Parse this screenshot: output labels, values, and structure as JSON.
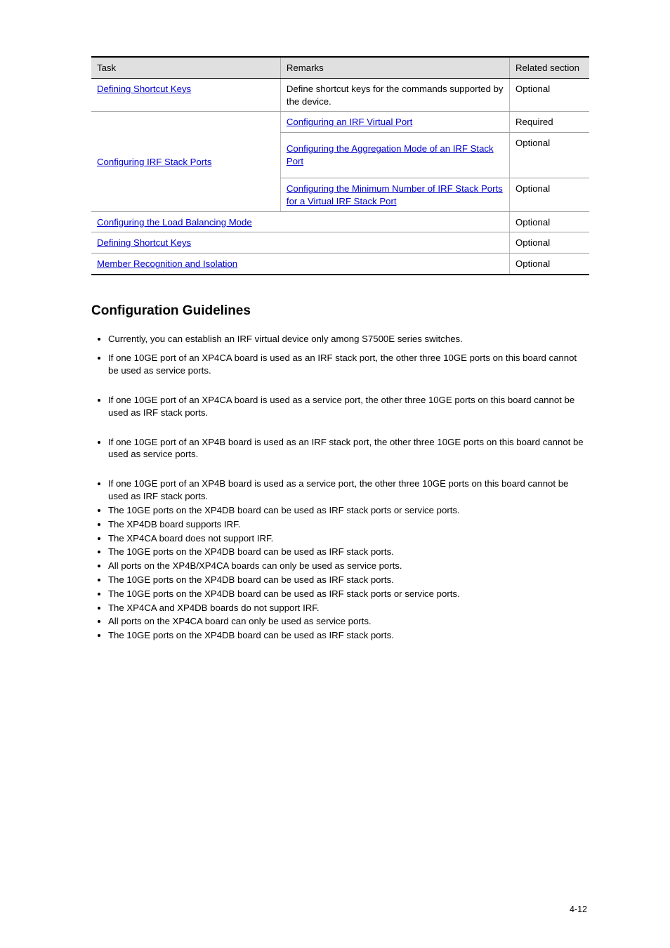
{
  "table": {
    "headers": {
      "task": "Task",
      "remarks": "Remarks",
      "related": "Related section"
    },
    "rows": [
      {
        "task_link": "Defining Shortcut Keys",
        "task_text": "",
        "remarks_pre": "Define shortcut keys for the commands supported by the device.",
        "remarks_links": [],
        "related": "Optional"
      },
      {
        "task_link": "",
        "task_text": "",
        "remarks_pre": "",
        "remarks_links": [
          {
            "text": "Configuring an IRF Virtual Port",
            "suffix": ""
          }
        ],
        "related": "Required"
      },
      {
        "task_link": "Configuring IRF Stack Ports",
        "task_text": "",
        "remarks_pre": "",
        "remarks_links": [
          {
            "text": "Configuring the Aggregation Mode of an IRF Stack Port",
            "suffix": ""
          }
        ],
        "related": "Optional"
      },
      {
        "task_link": "",
        "task_text": "",
        "remarks_pre": "",
        "remarks_links": [
          {
            "text": "Configuring the Minimum Number of IRF Stack Ports for a Virtual IRF Stack Port",
            "suffix": ""
          }
        ],
        "related": "Optional"
      },
      {
        "task_link": "Configuring the Load Balancing Mode",
        "task_text": "",
        "remarks_pre": "",
        "remarks_links": [],
        "related": "Optional"
      },
      {
        "task_link": "Defining Shortcut Keys",
        "task_text": "",
        "remarks_pre": "",
        "remarks_links": [],
        "related": "Optional"
      },
      {
        "task_link": "Member Recognition and Isolation",
        "task_text": "",
        "remarks_pre": "",
        "remarks_links": [],
        "related": "Optional"
      }
    ]
  },
  "section": {
    "heading": "Configuration Guidelines",
    "items": [
      {
        "text": "Currently, you can establish an IRF virtual device only among S7500E series switches.",
        "spacing": "sp-small"
      },
      {
        "text": "If one 10GE port of an XP4CA board is used as an IRF stack port, the other three 10GE ports on this board cannot be used as service ports.",
        "spacing": "sp"
      },
      {
        "text": "If one 10GE port of an XP4CA board is used as a service port, the other three 10GE ports on this board cannot be used as IRF stack ports.",
        "spacing": "sp"
      },
      {
        "text": "If one 10GE port of an XP4B board is used as an IRF stack port, the other three 10GE ports on this board cannot be used as service ports.",
        "spacing": "sp"
      },
      {
        "text": "If one 10GE port of an XP4B board is used as a service port, the other three 10GE ports on this board cannot be used as IRF stack ports.",
        "spacing": ""
      },
      {
        "text": "The 10GE ports on the XP4DB board can be used as IRF stack ports or service ports.",
        "spacing": ""
      },
      {
        "text": "The XP4DB board supports IRF.",
        "spacing": ""
      },
      {
        "text": "The XP4CA board does not support IRF.",
        "spacing": ""
      },
      {
        "text": "The 10GE ports on the XP4DB board can be used as IRF stack ports.",
        "spacing": ""
      },
      {
        "text": "All ports on the XP4B/XP4CA boards can only be used as service ports.",
        "spacing": ""
      },
      {
        "text": "The 10GE ports on the XP4DB board can be used as IRF stack ports.",
        "spacing": ""
      },
      {
        "text": "The 10GE ports on the XP4DB board can be used as IRF stack ports or service ports.",
        "spacing": ""
      },
      {
        "text": "The XP4CA and XP4DB boards do not support IRF.",
        "spacing": ""
      },
      {
        "text": "All ports on the XP4CA board can only be used as service ports.",
        "spacing": ""
      },
      {
        "text": "The 10GE ports on the XP4DB board can be used as IRF stack ports.",
        "spacing": ""
      }
    ]
  },
  "page_number": "4-12"
}
